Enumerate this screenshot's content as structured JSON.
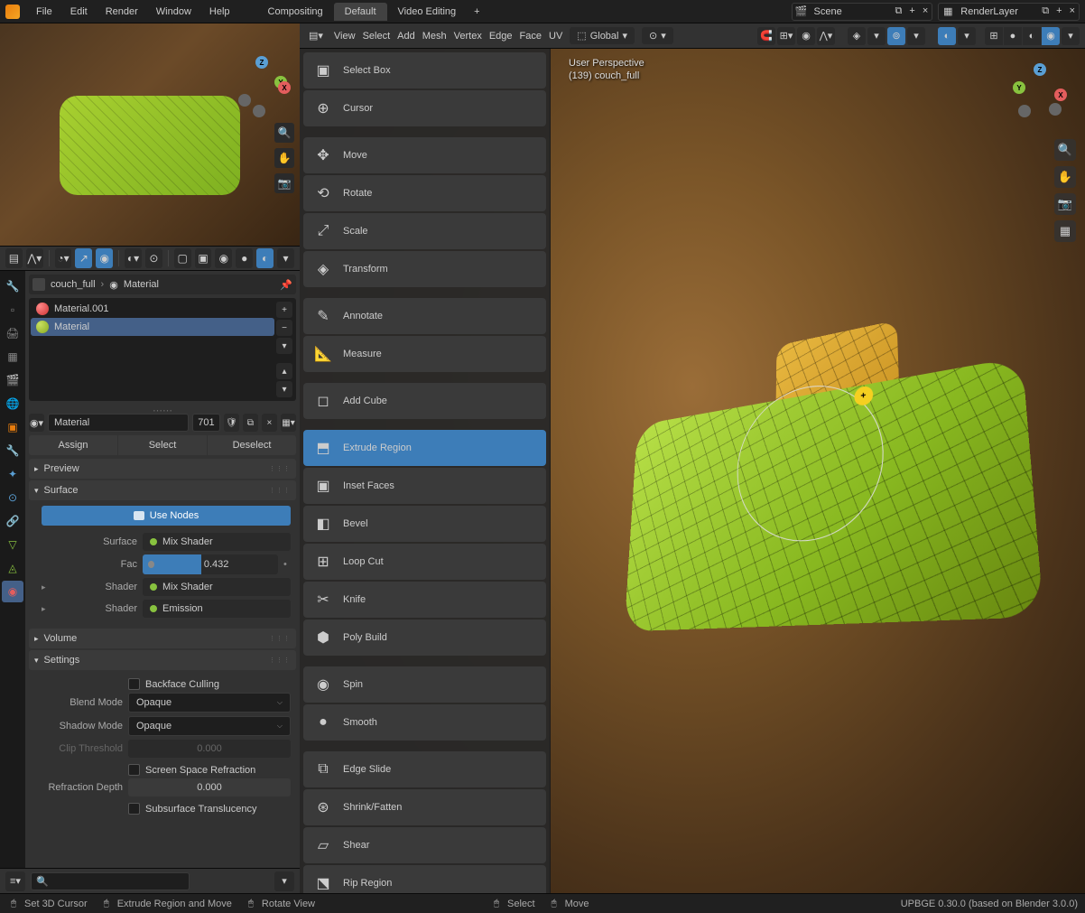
{
  "menu": {
    "file": "File",
    "edit": "Edit",
    "render": "Render",
    "window": "Window",
    "help": "Help"
  },
  "workspace_tabs": [
    "Compositing",
    "Default",
    "Video Editing"
  ],
  "workspace_active": 1,
  "scene_field": "Scene",
  "layer_field": "RenderLayer",
  "viewport_menu": {
    "view": "View",
    "select": "Select",
    "add": "Add",
    "mesh": "Mesh",
    "vertex": "Vertex",
    "edge": "Edge",
    "face": "Face",
    "uv": "UV"
  },
  "orientation": "Global",
  "overlay_text": {
    "line1": "User Perspective",
    "line2": "(139) couch_full"
  },
  "tools": [
    {
      "label": "Select Box",
      "icon": "▣"
    },
    {
      "label": "Cursor",
      "icon": "⊕"
    },
    {
      "label": "Move",
      "icon": "✥"
    },
    {
      "label": "Rotate",
      "icon": "⟲"
    },
    {
      "label": "Scale",
      "icon": "⤢"
    },
    {
      "label": "Transform",
      "icon": "◈"
    },
    {
      "label": "Annotate",
      "icon": "✎"
    },
    {
      "label": "Measure",
      "icon": "📐"
    },
    {
      "label": "Add Cube",
      "icon": "◻"
    },
    {
      "label": "Extrude Region",
      "icon": "⬒",
      "active": true
    },
    {
      "label": "Inset Faces",
      "icon": "▣"
    },
    {
      "label": "Bevel",
      "icon": "◧"
    },
    {
      "label": "Loop Cut",
      "icon": "⊞"
    },
    {
      "label": "Knife",
      "icon": "✂"
    },
    {
      "label": "Poly Build",
      "icon": "⬢"
    },
    {
      "label": "Spin",
      "icon": "◉"
    },
    {
      "label": "Smooth",
      "icon": "●"
    },
    {
      "label": "Edge Slide",
      "icon": "⧉"
    },
    {
      "label": "Shrink/Fatten",
      "icon": "⊛"
    },
    {
      "label": "Shear",
      "icon": "▱"
    },
    {
      "label": "Rip Region",
      "icon": "⬔"
    }
  ],
  "breadcrumb": {
    "object": "couch_full",
    "material": "Material"
  },
  "materials": [
    {
      "name": "Material.001",
      "color": "red"
    },
    {
      "name": "Material",
      "color": "green",
      "active": true
    }
  ],
  "material_name": "Material",
  "material_users": "701",
  "material_actions": {
    "assign": "Assign",
    "select": "Select",
    "deselect": "Deselect"
  },
  "panels": {
    "preview": "Preview",
    "surface": "Surface",
    "use_nodes": "Use Nodes",
    "surface_type_label": "Surface",
    "surface_type": "Mix Shader",
    "fac_label": "Fac",
    "fac_value": "0.432",
    "shader1_label": "Shader",
    "shader1_value": "Mix Shader",
    "shader2_label": "Shader",
    "shader2_value": "Emission",
    "volume": "Volume",
    "settings": "Settings",
    "backface_culling": "Backface Culling",
    "blend_mode_label": "Blend Mode",
    "blend_mode": "Opaque",
    "shadow_mode_label": "Shadow Mode",
    "shadow_mode": "Opaque",
    "clip_threshold_label": "Clip Threshold",
    "clip_threshold": "0.000",
    "screen_space_refraction": "Screen Space Refraction",
    "refraction_depth_label": "Refraction Depth",
    "refraction_depth": "0.000",
    "subsurface_translucency": "Subsurface Translucency"
  },
  "statusbar": {
    "set_cursor": "Set 3D Cursor",
    "extrude": "Extrude Region and Move",
    "rotate": "Rotate View",
    "select": "Select",
    "move": "Move",
    "version": "UPBGE 0.30.0 (based on Blender 3.0.0)"
  }
}
